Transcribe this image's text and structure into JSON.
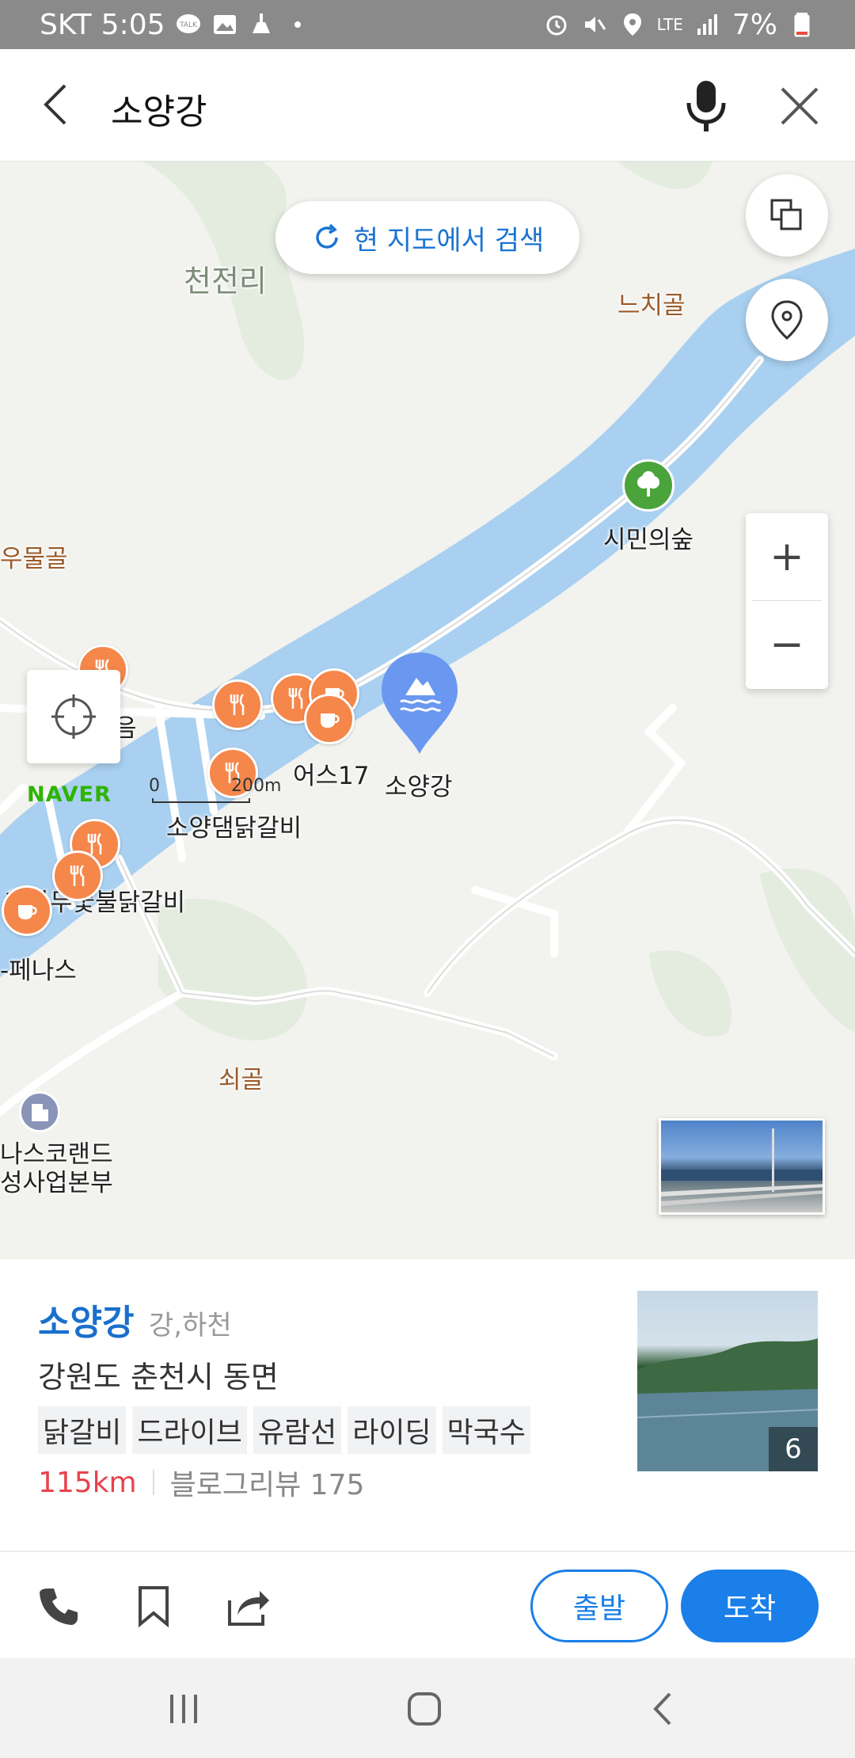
{
  "status_bar": {
    "carrier": "SKT",
    "time": "5:05",
    "battery": "7%",
    "left_icons": [
      "kakaotalk-icon",
      "gallery-icon",
      "cleaner-icon",
      "dot-icon"
    ],
    "right_icons": [
      "alarm-icon",
      "mute-icon",
      "location-icon",
      "lte-icon",
      "signal-icon",
      "battery-icon"
    ],
    "lte_label": "LTE"
  },
  "header": {
    "query": "소양강"
  },
  "map": {
    "research_label": "현 지도에서 검색",
    "naver_logo": "NAVER",
    "scale_min": "0",
    "scale_max": "200m",
    "place_labels": {
      "cheonjeonri": "천전리",
      "neuchigol": "느치골",
      "umulgol": "우물골",
      "simin_forest": "시민의숲",
      "eum": "음",
      "earth17": "어스17",
      "soyanggang": "소양강",
      "soyangdam_dakgalbi": "소양댐닭갈비",
      "chamnamu": "참나무숯불닭갈비",
      "penas": "-페나스",
      "soegol": "쇠골",
      "grand1": "나스코랜드",
      "grand2": "성사업본부"
    },
    "zoom_in": "+",
    "zoom_out": "−"
  },
  "place": {
    "name": "소양강",
    "category": "강,하천",
    "address": "강원도 춘천시 동면",
    "tags": [
      "닭갈비",
      "드라이브",
      "유람선",
      "라이딩",
      "막국수"
    ],
    "distance": "115km",
    "reviews": "블로그리뷰 175",
    "photo_count": "6"
  },
  "actions": {
    "depart": "출발",
    "arrive": "도착"
  },
  "colors": {
    "accent": "#1a7fe8",
    "river": "#a9d0f0",
    "poi": "#f5874b",
    "distance": "#e8424b"
  }
}
